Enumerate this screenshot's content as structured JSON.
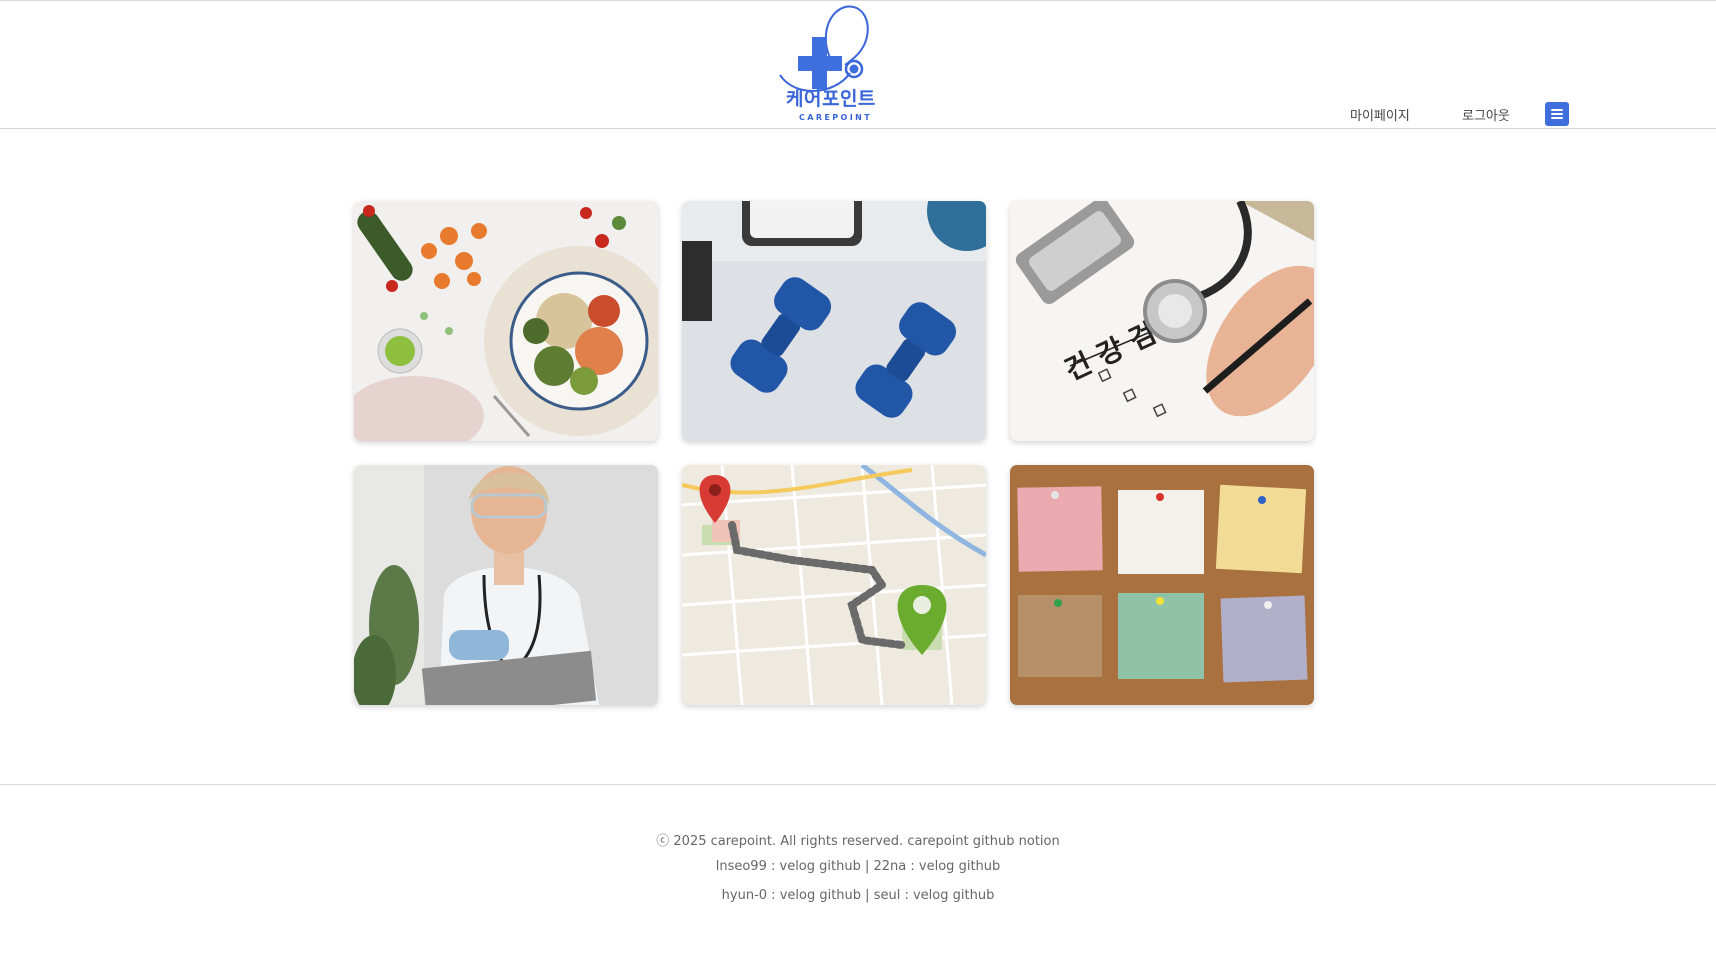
{
  "header": {
    "logo_text_ko": "케어포인트",
    "logo_text_en": "CAREPOINT",
    "nav": {
      "mypage_label": "마이페이지",
      "logout_label": "로그아웃"
    },
    "menu_icon": "hamburger-menu-icon"
  },
  "colors": {
    "brand_blue": "#3f6fdd",
    "border": "#d4d4d4",
    "footer_text": "#666666"
  },
  "cards": [
    {
      "name": "diet",
      "image": "healthy-food-bowl-image"
    },
    {
      "name": "exercise",
      "image": "dumbbells-image"
    },
    {
      "name": "checkup",
      "image": "health-checkup-form-image",
      "image_text": "건 강 검 진"
    },
    {
      "name": "doctor",
      "image": "doctor-with-clipboard-image"
    },
    {
      "name": "map",
      "image": "map-route-image"
    },
    {
      "name": "memo",
      "image": "sticky-notes-board-image"
    }
  ],
  "footer": {
    "copyright_symbol": "ⓒ",
    "copyright_text": "2025 carepoint. All rights reserved.",
    "carepoint_label": "carepoint",
    "github_label": "github",
    "notion_label": "notion",
    "members": [
      {
        "name": "lnseo99",
        "velog": "velog",
        "github": "github"
      },
      {
        "name": "22na",
        "velog": "velog",
        "github": "github"
      },
      {
        "name": "hyun-0",
        "velog": "velog",
        "github": "github"
      },
      {
        "name": "seul",
        "velog": "velog",
        "github": "github"
      }
    ]
  }
}
